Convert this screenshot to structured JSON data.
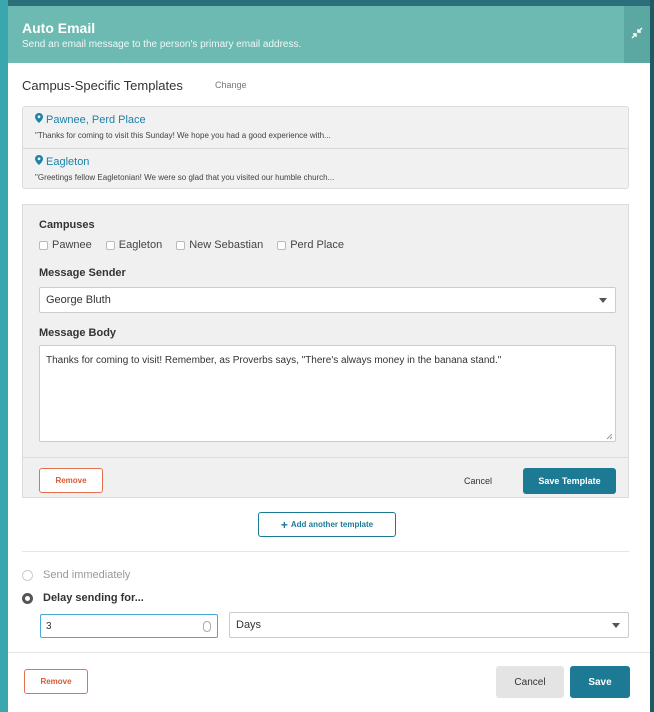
{
  "header": {
    "title": "Auto Email",
    "subtitle": "Send an email message to the person's primary email address."
  },
  "templates_section": {
    "title": "Campus-Specific Templates",
    "change_label": "Change",
    "items": [
      {
        "name": "Pawnee, Perd Place",
        "preview": "\"Thanks for coming to visit this Sunday! We hope you had a good experience with..."
      },
      {
        "name": "Eagleton",
        "preview": "\"Greetings fellow Eagletonian! We were so glad that you visited our humble church..."
      }
    ]
  },
  "editor": {
    "campuses_label": "Campuses",
    "campuses": [
      "Pawnee",
      "Eagleton",
      "New Sebastian",
      "Perd Place"
    ],
    "sender_label": "Message Sender",
    "sender_value": "George Bluth",
    "body_label": "Message Body",
    "body_value": "Thanks for coming to visit! Remember, as Proverbs says, \"There's always money in the banana stand.\"",
    "remove_label": "Remove",
    "cancel_label": "Cancel",
    "save_template_label": "Save Template"
  },
  "add_template_label": "Add another template",
  "timing": {
    "send_immediately_label": "Send immediately",
    "delay_label": "Delay sending for...",
    "delay_value": "3",
    "delay_unit": "Days",
    "selected": "delay"
  },
  "footer": {
    "remove_label": "Remove",
    "cancel_label": "Cancel",
    "save_label": "Save"
  },
  "colors": {
    "header": "#6dbab3",
    "primary": "#1d7a94",
    "danger": "#d55a35",
    "link": "#1d82a8"
  }
}
